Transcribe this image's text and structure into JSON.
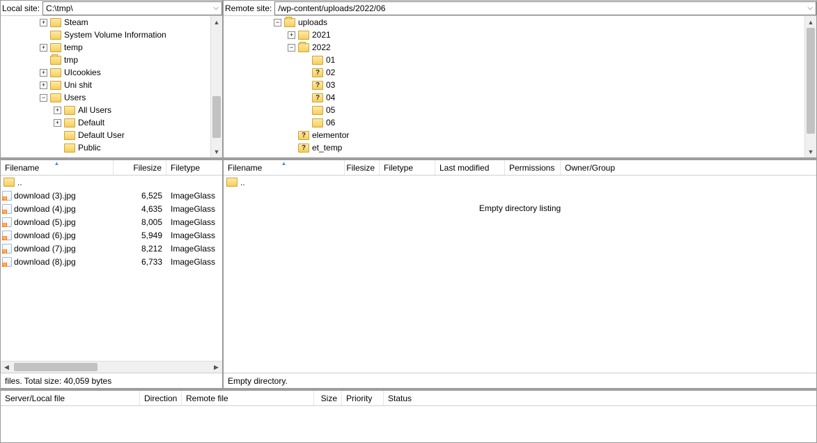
{
  "local": {
    "label": "Local site:",
    "path": "C:\\tmp\\",
    "tree": [
      {
        "indent": 56,
        "exp": "+",
        "name": "Steam"
      },
      {
        "indent": 56,
        "exp": "",
        "name": "System Volume Information"
      },
      {
        "indent": 56,
        "exp": "+",
        "name": "temp"
      },
      {
        "indent": 56,
        "exp": "",
        "name": "tmp",
        "open": true
      },
      {
        "indent": 56,
        "exp": "+",
        "name": "UIcookies"
      },
      {
        "indent": 56,
        "exp": "+",
        "name": "Uni shit"
      },
      {
        "indent": 56,
        "exp": "-",
        "name": "Users"
      },
      {
        "indent": 76,
        "exp": "+",
        "name": "All Users"
      },
      {
        "indent": 76,
        "exp": "+",
        "name": "Default"
      },
      {
        "indent": 76,
        "exp": "",
        "name": "Default User"
      },
      {
        "indent": 76,
        "exp": "",
        "name": "Public"
      }
    ],
    "columns": [
      "Filename",
      "Filesize",
      "Filetype"
    ],
    "parent": "..",
    "files": [
      {
        "name": "download (3).jpg",
        "size": "6,525",
        "type": "ImageGlass"
      },
      {
        "name": "download (4).jpg",
        "size": "4,635",
        "type": "ImageGlass"
      },
      {
        "name": "download (5).jpg",
        "size": "8,005",
        "type": "ImageGlass"
      },
      {
        "name": "download (6).jpg",
        "size": "5,949",
        "type": "ImageGlass"
      },
      {
        "name": "download (7).jpg",
        "size": "8,212",
        "type": "ImageGlass"
      },
      {
        "name": "download (8).jpg",
        "size": "6,733",
        "type": "ImageGlass"
      }
    ],
    "status": " files. Total size: 40,059 bytes"
  },
  "remote": {
    "label": "Remote site:",
    "path": "/wp-content/uploads/2022/06",
    "tree": [
      {
        "indent": 72,
        "exp": "-",
        "name": "uploads",
        "open": true
      },
      {
        "indent": 92,
        "exp": "+",
        "name": "2021"
      },
      {
        "indent": 92,
        "exp": "-",
        "name": "2022",
        "open": true
      },
      {
        "indent": 112,
        "exp": "",
        "name": "01"
      },
      {
        "indent": 112,
        "exp": "",
        "name": "02",
        "q": true
      },
      {
        "indent": 112,
        "exp": "",
        "name": "03",
        "q": true
      },
      {
        "indent": 112,
        "exp": "",
        "name": "04",
        "q": true
      },
      {
        "indent": 112,
        "exp": "",
        "name": "05"
      },
      {
        "indent": 112,
        "exp": "",
        "name": "06"
      },
      {
        "indent": 92,
        "exp": "",
        "name": "elementor",
        "q": true
      },
      {
        "indent": 92,
        "exp": "",
        "name": "et_temp",
        "q": true
      }
    ],
    "columns": [
      "Filename",
      "Filesize",
      "Filetype",
      "Last modified",
      "Permissions",
      "Owner/Group"
    ],
    "parent": "..",
    "empty_msg": "Empty directory listing",
    "status": "Empty directory."
  },
  "queue": {
    "columns": [
      "Server/Local file",
      "Direction",
      "Remote file",
      "Size",
      "Priority",
      "Status"
    ]
  }
}
